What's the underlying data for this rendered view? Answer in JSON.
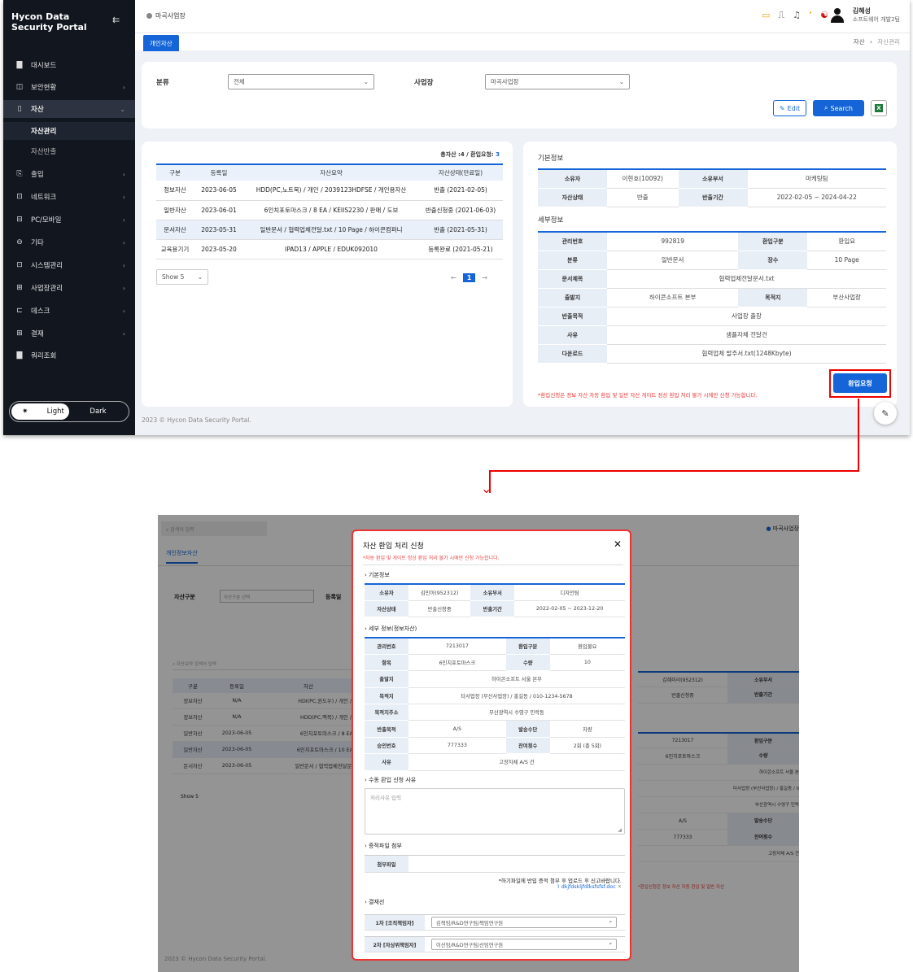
{
  "top": {
    "brand": "Hycon Data Security Portal",
    "nav": [
      {
        "label": "대시보드",
        "icon": "dashboard-icon",
        "glyph": "▇",
        "chev": ""
      },
      {
        "label": "보안현황",
        "icon": "chart-icon",
        "glyph": "◫",
        "chev": "›"
      },
      {
        "label": "자산",
        "icon": "asset-icon",
        "glyph": "▯",
        "chev": "⌄"
      },
      {
        "label": "출입",
        "icon": "access-icon",
        "glyph": "⎘",
        "chev": "›"
      },
      {
        "label": "네트워크",
        "icon": "network-icon",
        "glyph": "⊡",
        "chev": "›"
      },
      {
        "label": "PC/모바일",
        "icon": "pc-icon",
        "glyph": "⊟",
        "chev": "›"
      },
      {
        "label": "기타",
        "icon": "etc-icon",
        "glyph": "⊖",
        "chev": "›"
      },
      {
        "label": "시스템관리",
        "icon": "system-icon",
        "glyph": "⊡",
        "chev": "›"
      },
      {
        "label": "사업장관리",
        "icon": "building-icon",
        "glyph": "⊞",
        "chev": "›"
      },
      {
        "label": "데스크",
        "icon": "desk-icon",
        "glyph": "⊏",
        "chev": "›"
      },
      {
        "label": "결재",
        "icon": "approval-icon",
        "glyph": "⊞",
        "chev": "›"
      },
      {
        "label": "쿼리조회",
        "icon": "query-icon",
        "glyph": "▇",
        "chev": ""
      }
    ],
    "subnav": [
      "자산관리",
      "자산반출"
    ],
    "theme": {
      "light": "Light",
      "dark": "Dark"
    },
    "site": "마곡사업장",
    "user": {
      "name": "김혜성",
      "team": "소프트웨어 개발2팀"
    },
    "tab": "개인자산",
    "breadcrumb": {
      "first": "자산",
      "sep": "›",
      "last": "자산관리"
    },
    "filter": {
      "category_label": "분류",
      "category_value": "전체",
      "site_label": "사업장",
      "site_value": "마곡사업장",
      "edit": "Edit",
      "search": "Search"
    },
    "summary": {
      "text": "총자산 :4 / 환입요청: ",
      "count": "3"
    },
    "columns": [
      "구분",
      "등록일",
      "자산요약",
      "자산상태(만료일)"
    ],
    "rows": [
      [
        "정보자산",
        "2023-06-05",
        "HDD(PC,노트북) / 개인 / 2039123HDFSE / 개인용자산",
        "반출 (2021-02-05)"
      ],
      [
        "일반자산",
        "2023-06-01",
        "6인치포토마스크 / 8 EA / KEIIS2230 / 판매 / 도보",
        "반출신청중 (2021-06-03)"
      ],
      [
        "문서자산",
        "2023-05-31",
        "일반문서 / 협력업체전달.txt / 10 Page / 하이콘컴퍼니",
        "반출 (2021-05-31)"
      ],
      [
        "교육용기기",
        "2023-05-20",
        "IPAD13 / APPLE / EDUK092010",
        "등록완료 (2021-05-21)"
      ]
    ],
    "show": "Show 5",
    "page": "1",
    "basic_title": "기본정보",
    "basic": [
      [
        "소유자",
        "이현호(10092)",
        "소유부서",
        "마케팅팀"
      ],
      [
        "자산상태",
        "반출",
        "반출기간",
        "2022-02-05 ~ 2024-04-22"
      ]
    ],
    "detail_title": "세부정보",
    "detail": [
      [
        "관리번호",
        "992819",
        "환입구분",
        "환입요"
      ],
      [
        "분류",
        "일반문서",
        "장수",
        "10 Page"
      ],
      [
        "문서제목",
        "협력업체전달문서.txt"
      ],
      [
        "출발지",
        "하이콘소프트 본부",
        "목적지",
        "부산사업장"
      ],
      [
        "반출목적",
        "사업장 출장"
      ],
      [
        "사유",
        "샘플자체 전달건"
      ],
      [
        "다운로드",
        "협력업체 발주서.txt(1248Kbyte)"
      ]
    ],
    "return_button": "환입요청",
    "notice": "*환입신청은 정보 자산 자동 환입 및 일반 자산 게이트 정상 환입 처리 불가 시에만 신청 가능합니다.",
    "footer": "2023 © Hycon Data Security Portal."
  },
  "bottom": {
    "search_placeholder": "검색어 입력",
    "site": "마곡사업장",
    "tab": "개인정보자산",
    "filter_label": "자산구분",
    "filter_value": "자산구분 선택",
    "filter_label2": "등록일",
    "list_search": "자산요약 검색어 입력",
    "columns": [
      "구분",
      "등록일",
      "자산"
    ],
    "rows": [
      [
        "정보자산",
        "N/A",
        "HDI(PC,윈도우) / 개인 / 2"
      ],
      [
        "정보자산",
        "N/A",
        "HDD(PC,맥북) / 개인 / 2"
      ],
      [
        "일반자산",
        "2023-06-05",
        "6인치포토마스크 / 8 EA /"
      ],
      [
        "일반자산",
        "2023-06-05",
        "6인치포토마스크 / 10 EA /"
      ],
      [
        "문서자산",
        "2023-06-05",
        "일반문서 / 협력업체전달문서"
      ]
    ],
    "show": "Show 5",
    "right": [
      [
        "김혜미리(952312)",
        "소유부서"
      ],
      [
        "반출신청중",
        "반출기간"
      ],
      [
        "7213017",
        "환입구분"
      ],
      [
        "6인치포토마스크",
        "수량"
      ],
      [
        "",
        "하이콘소프트 서울 본"
      ],
      [
        "",
        "타사업장 (부산사업장) / 홍길동 / 0"
      ],
      [
        "",
        "부산광역시 수영구 민락"
      ],
      [
        "A/S",
        "발송수단"
      ],
      [
        "777333",
        "잔여횟수"
      ],
      [
        "",
        "고장자체 A/S 건"
      ]
    ],
    "notice": "*환입신청은 정보 자산 자동 환입 및 일반 자산",
    "footer": "2023 © Hycon Data Security Portal."
  },
  "modal": {
    "title": "자산 환입 처리 신청",
    "subtitle": "*자동 환입 및 게이트 정상 환입 처리 불가 시에만 신청 가능합니다.",
    "basic_title": "기본정보",
    "basic": [
      [
        "소유자",
        "김민아(952312)",
        "소유부서",
        "디자인팀"
      ],
      [
        "자산상태",
        "반출신청중",
        "반출기간",
        "2022-02-05 ~ 2023-12-20"
      ]
    ],
    "detail_title": "세부 정보(정보자산)",
    "detail": [
      [
        "관리번호",
        "7213017",
        "환입구분",
        "환입불요"
      ],
      [
        "항목",
        "6인치포토마스크",
        "수량",
        "10"
      ],
      [
        "출발지",
        "하이콘소프트 서울 본부"
      ],
      [
        "목적지",
        "타사업장 (부산사업장) / 홍길동 / 010-1234-5678"
      ],
      [
        "목적지주소",
        "부산광역시 수영구 민락동"
      ],
      [
        "반출목적",
        "A/S",
        "발송수단",
        "차량"
      ],
      [
        "승인번호",
        "777333",
        "잔여횟수",
        "2회 (총 5회)"
      ],
      [
        "사유",
        "고장자체 A/S 건"
      ]
    ],
    "reason_title": "수동 환입 신청 사유",
    "reason_placeholder": "처리사유 입력",
    "file_title": "증적파일 첨부",
    "file_label": "첨부파일",
    "file_notice": "*하기파일에 반입 증적 첨부 후 업로드 후 신고바랍니다.",
    "file_name": "dkjfdskljfdlksfsfsf.doc",
    "approval_title": "결재선",
    "approvers": [
      {
        "label": "1차 [조직책임자]",
        "value": "김책임/R&D연구팀/책임연구원"
      },
      {
        "label": "2차 [자상위책임자]",
        "value": "이선임/R&D연구팀/선임연구원"
      }
    ]
  }
}
